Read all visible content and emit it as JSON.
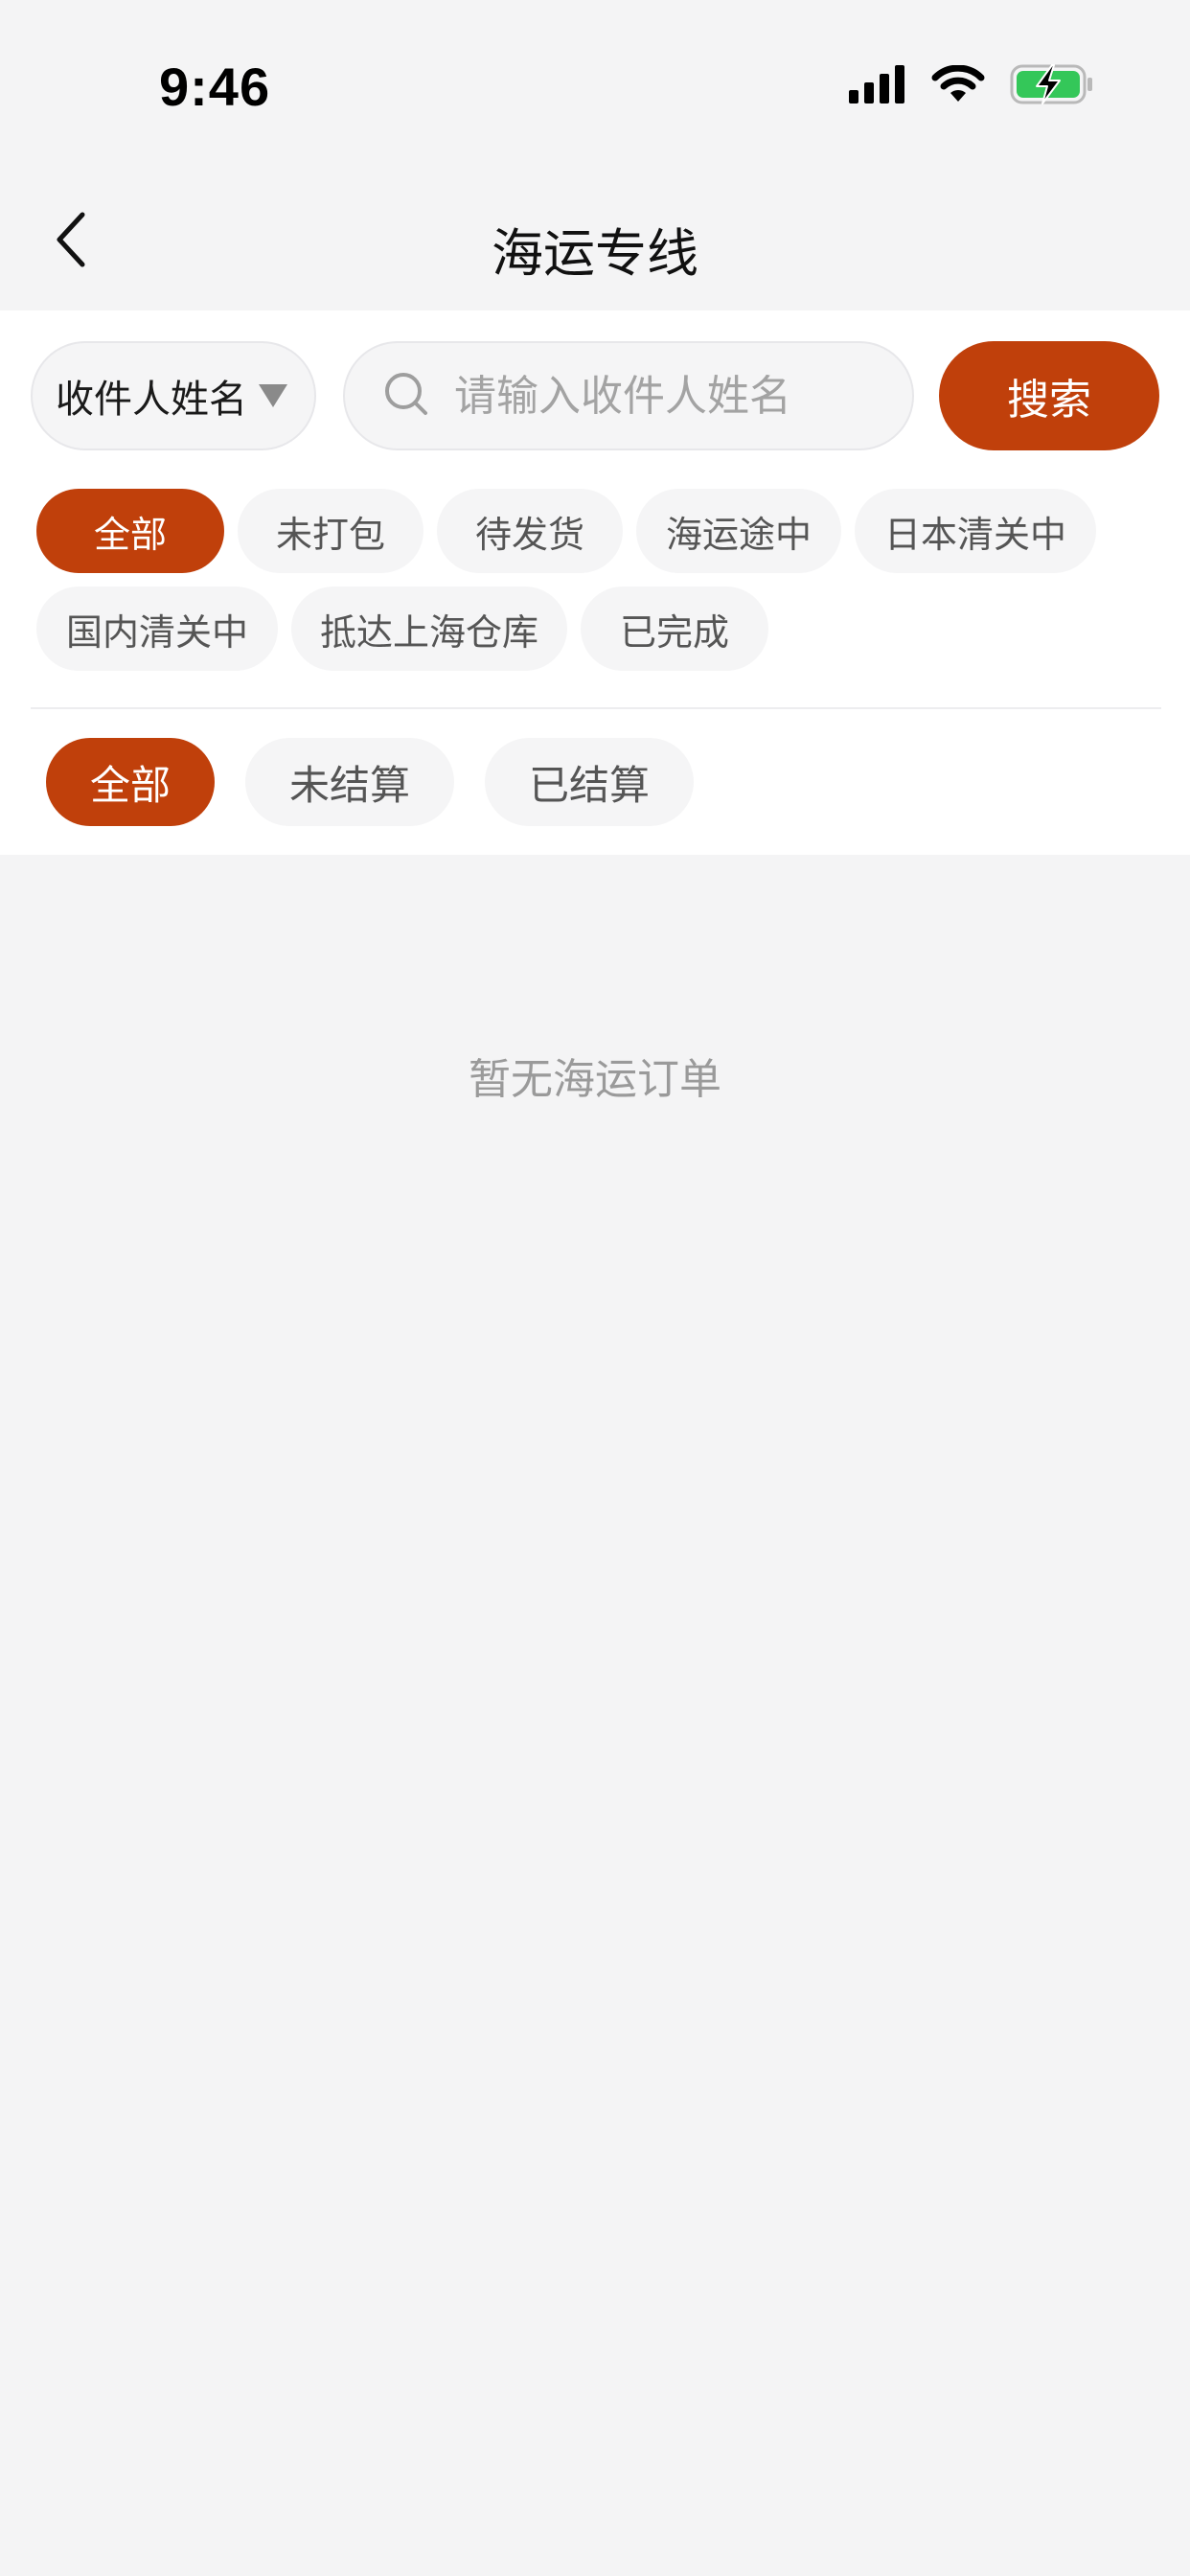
{
  "status_bar": {
    "time": "9:46",
    "icons": [
      "signal-icon",
      "wifi-icon",
      "battery-charging-icon"
    ],
    "battery_color": "#34c759"
  },
  "nav": {
    "back_icon": "chevron-left-icon",
    "title": "海运专线"
  },
  "search": {
    "field_select_label": "收件人姓名",
    "placeholder": "请输入收件人姓名",
    "button_label": "搜索"
  },
  "status_filters": [
    {
      "label": "全部",
      "active": true
    },
    {
      "label": "未打包",
      "active": false
    },
    {
      "label": "待发货",
      "active": false
    },
    {
      "label": "海运途中",
      "active": false
    },
    {
      "label": "日本清关中",
      "active": false
    },
    {
      "label": "国内清关中",
      "active": false
    },
    {
      "label": "抵达上海仓库",
      "active": false
    },
    {
      "label": "已完成",
      "active": false
    }
  ],
  "settle_filters": [
    {
      "label": "全部",
      "active": true
    },
    {
      "label": "未结算",
      "active": false
    },
    {
      "label": "已结算",
      "active": false
    }
  ],
  "empty_state": "暂无海运订单",
  "colors": {
    "accent": "#c0400b",
    "background": "#f4f4f5",
    "chip_bg": "#f5f5f6"
  }
}
